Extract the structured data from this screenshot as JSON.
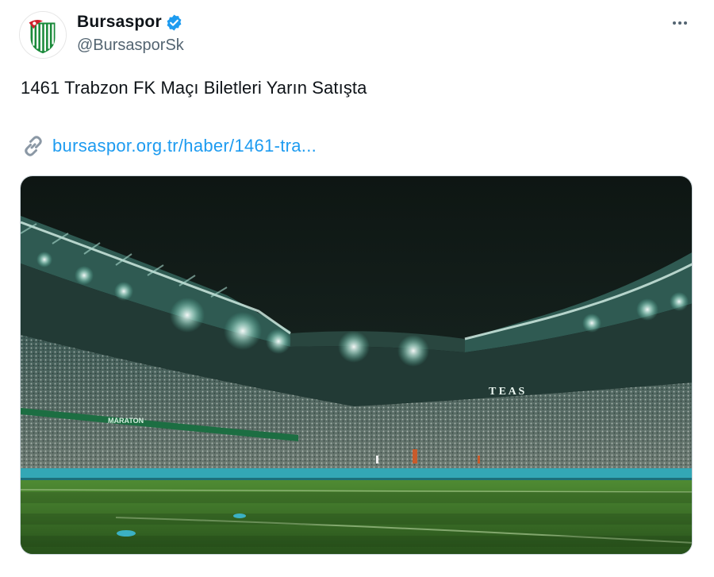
{
  "tweet": {
    "author": {
      "display_name": "Bursaspor",
      "handle": "@BursasporSk",
      "verified": true,
      "avatar_icon": "bursaspor-crest-icon"
    },
    "text": "1461 Trabzon FK Maçı Biletleri Yarın Satışta",
    "link": {
      "icon": "link-icon",
      "text": "bursaspor.org.tr/haber/1461-tra..."
    },
    "media": {
      "description_icon": "stadium-photo",
      "banners": [
        "MARATON",
        "T E A S"
      ]
    },
    "more_icon": "more-dots-icon"
  },
  "colors": {
    "link": "#1d9bf0",
    "verified_badge": "#1d9bf0",
    "handle": "#536471",
    "text": "#0f1419",
    "brand_green": "#1a8a3a"
  }
}
